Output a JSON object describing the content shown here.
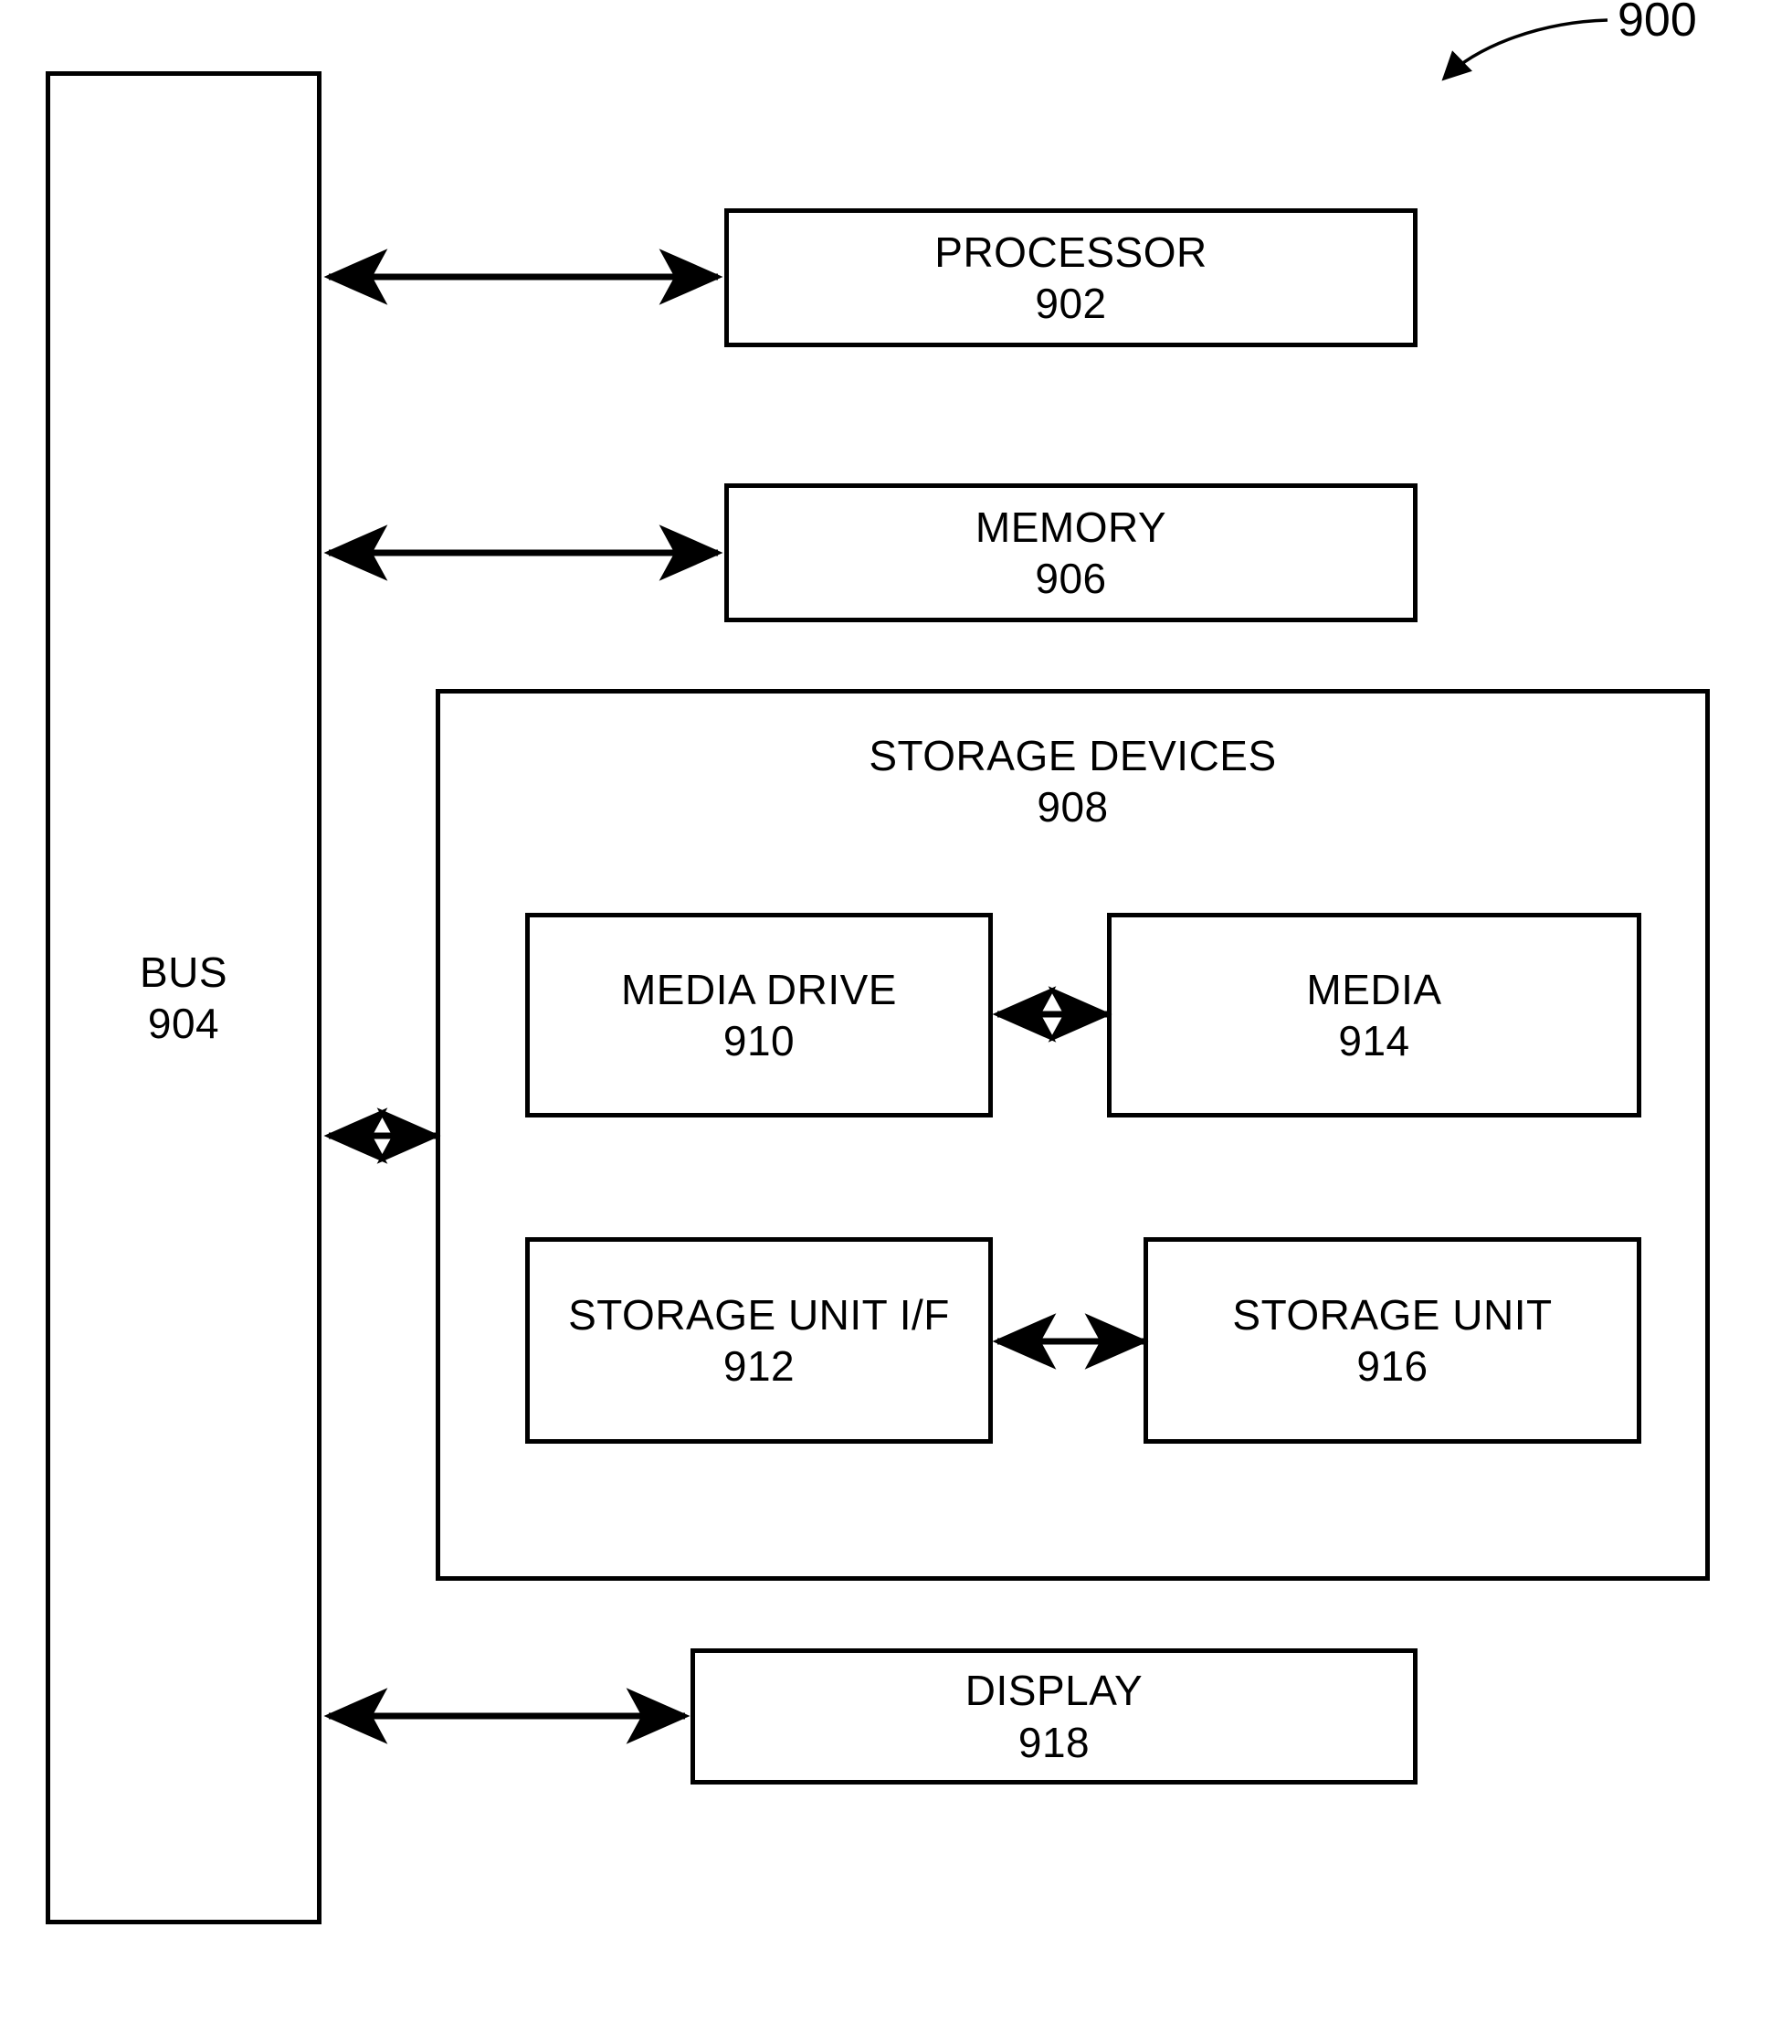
{
  "figure": {
    "number": "900",
    "type": "block-diagram"
  },
  "blocks": {
    "bus": {
      "label": "BUS",
      "ref": "904"
    },
    "processor": {
      "label": "PROCESSOR",
      "ref": "902"
    },
    "memory": {
      "label": "MEMORY",
      "ref": "906"
    },
    "storage_devices": {
      "label": "STORAGE DEVICES",
      "ref": "908"
    },
    "media_drive": {
      "label": "MEDIA DRIVE",
      "ref": "910"
    },
    "media": {
      "label": "MEDIA",
      "ref": "914"
    },
    "storage_unit_if": {
      "label": "STORAGE UNIT I/F",
      "ref": "912"
    },
    "storage_unit": {
      "label": "STORAGE UNIT",
      "ref": "916"
    },
    "display": {
      "label": "DISPLAY",
      "ref": "918"
    }
  },
  "connections": [
    {
      "name": "bus-processor",
      "from": "bus",
      "to": "processor",
      "style": "double-arrow"
    },
    {
      "name": "bus-memory",
      "from": "bus",
      "to": "memory",
      "style": "double-arrow"
    },
    {
      "name": "bus-storage-devices",
      "from": "bus",
      "to": "storage_devices",
      "style": "double-arrow"
    },
    {
      "name": "media-drive-media",
      "from": "media_drive",
      "to": "media",
      "style": "double-arrow"
    },
    {
      "name": "storage-unit-if-storage-unit",
      "from": "storage_unit_if",
      "to": "storage_unit",
      "style": "double-arrow"
    },
    {
      "name": "bus-display",
      "from": "bus",
      "to": "display",
      "style": "double-arrow"
    }
  ],
  "colors": {
    "stroke": "#000000",
    "background": "#ffffff"
  }
}
